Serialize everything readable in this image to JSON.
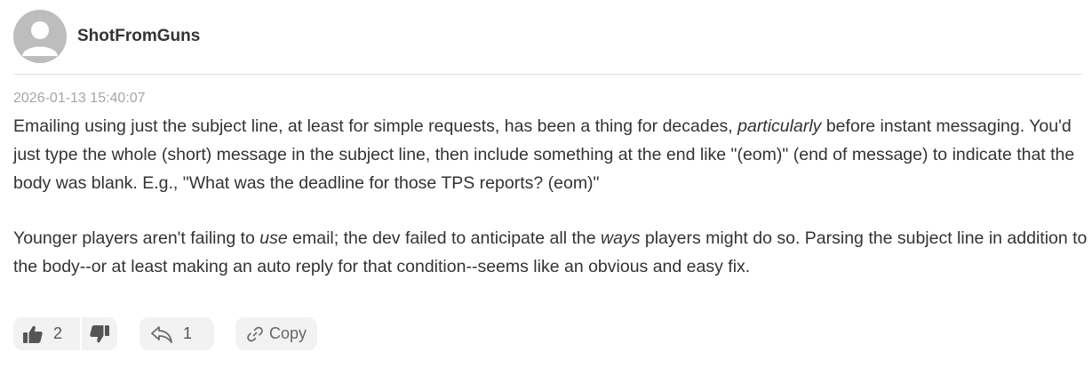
{
  "comment": {
    "author": "ShotFromGuns",
    "timestamp": "2026-01-13 15:40:07",
    "paragraph1": {
      "part1": "Emailing using just the subject line, at least for simple requests, has been a thing for decades, ",
      "em1": "particularly",
      "part2": " before instant messaging. You'd just type the whole (short) message in the subject line, then include something at the end like \"(eom)\" (end of message) to indicate that the body was blank. E.g., \"What was the deadline for those TPS reports? (eom)\""
    },
    "paragraph2": {
      "part1": "Younger players aren't failing to ",
      "em1": "use",
      "part2": " email; the dev failed to anticipate all the ",
      "em2": "ways",
      "part3": " players might do so. Parsing the subject line in addition to the body--or at least making an auto reply for that condition--seems like an obvious and easy fix."
    }
  },
  "actions": {
    "upvote_count": "2",
    "reply_count": "1",
    "copy_label": "Copy"
  },
  "icons": {
    "avatar": "user-avatar-icon",
    "upvote": "thumbs-up-icon",
    "downvote": "thumbs-down-icon",
    "reply": "reply-icon",
    "copy": "link-icon"
  },
  "colors": {
    "text": "#333333",
    "muted": "#a6a6a6",
    "pill_bg": "#f2f2f2",
    "icon": "#666666"
  }
}
